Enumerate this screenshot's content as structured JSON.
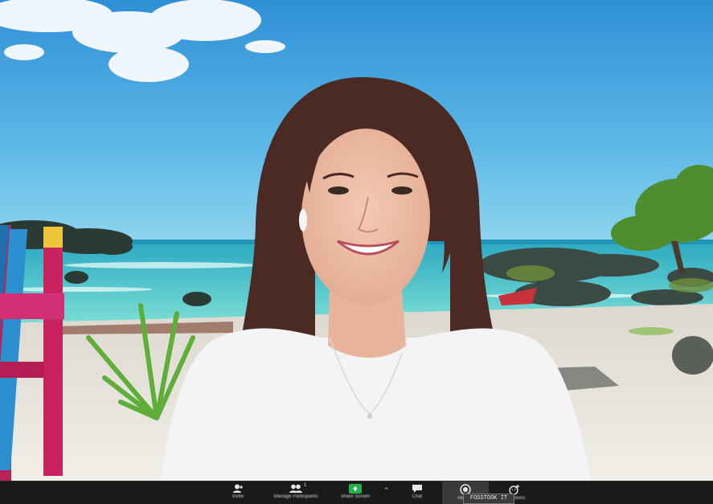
{
  "toolbar": {
    "invite": {
      "label": "Invite",
      "icon": "add-person-icon"
    },
    "participants": {
      "label": "Manage Participants",
      "count": "1",
      "icon": "participants-icon"
    },
    "share": {
      "label": "Share Screen",
      "icon": "share-screen-icon",
      "color": "#22b14c"
    },
    "more": {
      "icon": "chevron-up-icon"
    },
    "chat": {
      "label": "Chat",
      "icon": "chat-icon"
    },
    "record": {
      "label": "Record",
      "icon": "record-icon",
      "overlay": "FOSSTOOK IT"
    },
    "reactions": {
      "label": "Reactions",
      "icon": "reactions-icon"
    }
  },
  "colors": {
    "sky_top": "#3d9bd8",
    "sea": "#3cc6c0",
    "sand": "#e9e6df",
    "toolbar": "#1a1a1a"
  }
}
